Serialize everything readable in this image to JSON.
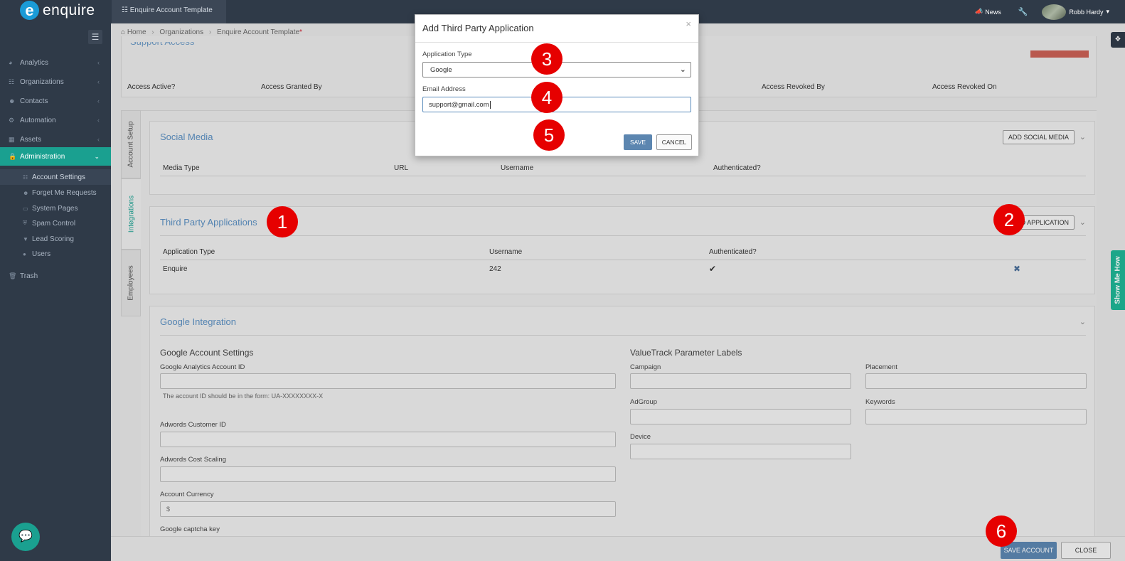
{
  "app": {
    "logo_letter": "e",
    "logo_text": "enquire"
  },
  "topbar": {
    "tab_label": "Enquire Account Template",
    "news_label": "News",
    "user_name": "Robb Hardy"
  },
  "sidebar": {
    "items": [
      {
        "label": "Analytics"
      },
      {
        "label": "Organizations"
      },
      {
        "label": "Contacts"
      },
      {
        "label": "Automation"
      },
      {
        "label": "Assets"
      },
      {
        "label": "Administration"
      }
    ],
    "sub_items": [
      {
        "label": "Account Settings"
      },
      {
        "label": "Forget Me Requests"
      },
      {
        "label": "System Pages"
      },
      {
        "label": "Spam Control"
      },
      {
        "label": "Lead Scoring"
      },
      {
        "label": "Users"
      }
    ],
    "trash_label": "Trash"
  },
  "breadcrumb": {
    "home": "Home",
    "organizations": "Organizations",
    "current": "Enquire Account Template",
    "required_mark": "*"
  },
  "support_access": {
    "title": "Support Access",
    "columns": [
      "Access Active?",
      "Access Granted By",
      "Access Revoked By",
      "Access Revoked On"
    ]
  },
  "vertical_tabs": [
    "Account Setup",
    "Integrations",
    "Employees"
  ],
  "social_media": {
    "title": "Social Media",
    "add_button": "ADD SOCIAL MEDIA",
    "columns": [
      "Media Type",
      "URL",
      "Username",
      "Authenticated?"
    ]
  },
  "third_party": {
    "title": "Third Party Applications",
    "add_button": "ADD APPLICATION",
    "columns": [
      "Application Type",
      "Username",
      "Authenticated?"
    ],
    "rows": [
      {
        "type": "Enquire",
        "username": "242",
        "authenticated": "✔",
        "remove": "✖"
      }
    ]
  },
  "google_integration": {
    "title": "Google Integration",
    "account_settings_heading": "Google Account Settings",
    "ga_label": "Google Analytics Account ID",
    "ga_help": "The account ID should be in the form: UA-XXXXXXXX-X",
    "adwords_id_label": "Adwords Customer ID",
    "adwords_scaling_label": "Adwords Cost Scaling",
    "currency_label": "Account Currency",
    "currency_value": "$",
    "captcha_label": "Google captcha key",
    "valuetrack_heading": "ValueTrack Parameter Labels",
    "campaign_label": "Campaign",
    "placement_label": "Placement",
    "adgroup_label": "AdGroup",
    "keywords_label": "Keywords",
    "device_label": "Device"
  },
  "footer": {
    "save_account": "SAVE ACCOUNT",
    "close": "CLOSE"
  },
  "show_me_how": "Show Me How",
  "modal": {
    "title": "Add Third Party Application",
    "close_glyph": "×",
    "app_type_label": "Application Type",
    "app_type_value": "Google",
    "email_label": "Email Address",
    "email_value": "support@gmail.com",
    "save": "SAVE",
    "cancel": "CANCEL"
  },
  "steps": [
    "1",
    "2",
    "3",
    "4",
    "5",
    "6"
  ],
  "colors": {
    "sidebar_bg": "#2f3a48",
    "active_accent": "#1aa090",
    "primary_button": "#5c86b0",
    "section_title": "#5b8fc1",
    "step_marker": "#e60000",
    "show_me_how": "#1fb595"
  }
}
